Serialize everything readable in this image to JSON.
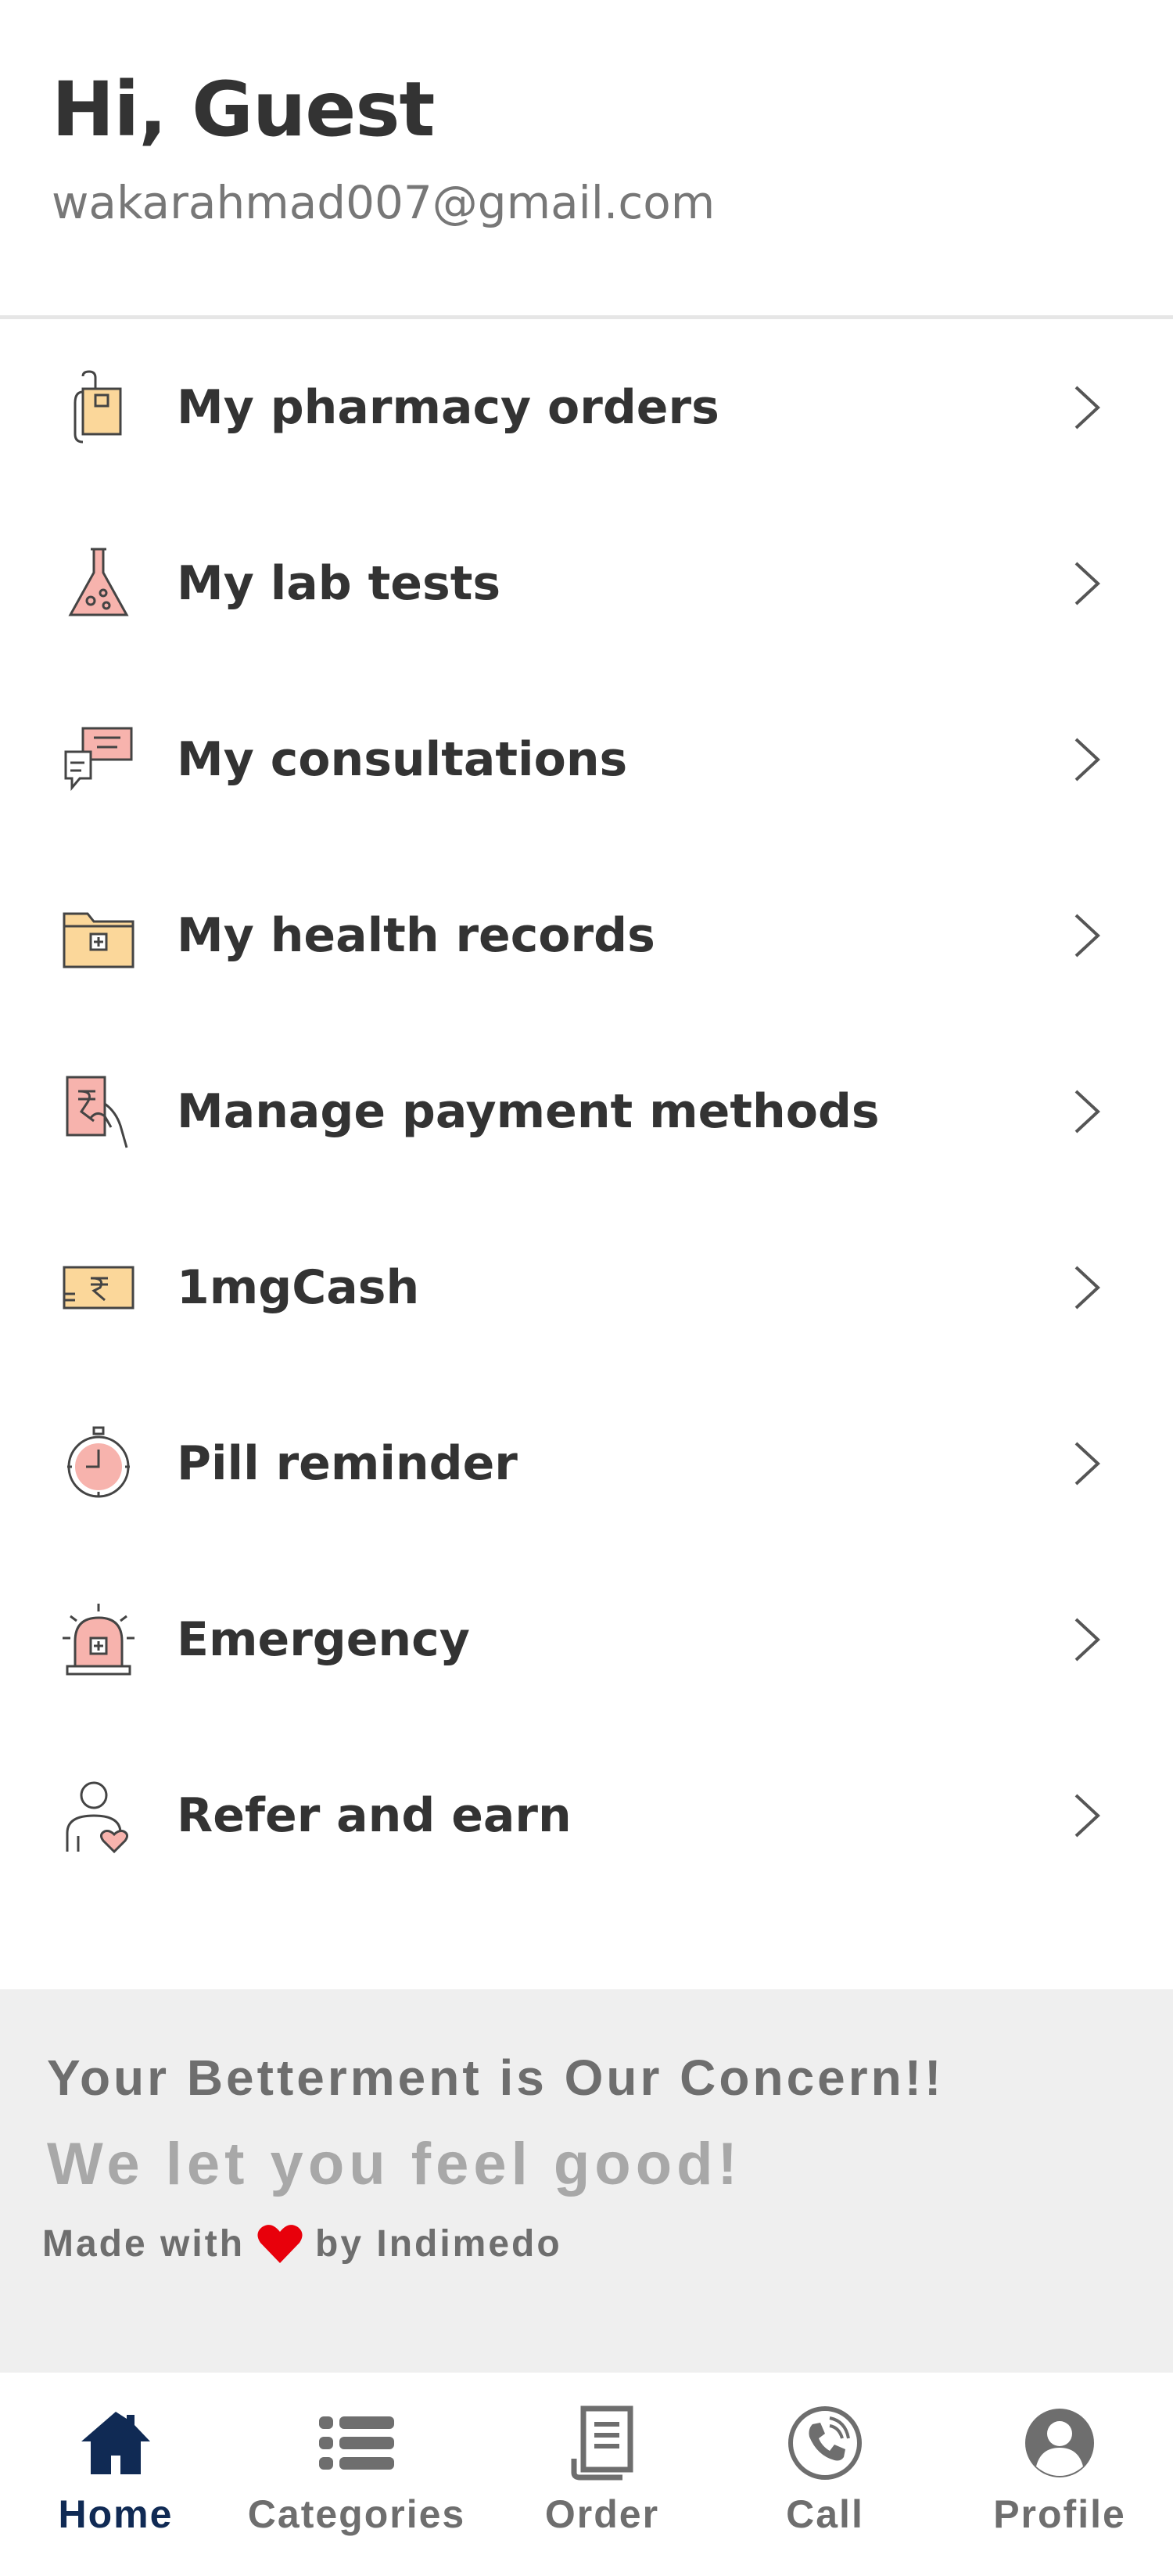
{
  "header": {
    "greeting": "Hi, Guest",
    "email": "wakarahmad007@gmail.com"
  },
  "menu": {
    "items": [
      {
        "label": "My pharmacy orders",
        "icon": "pharmacy-bag-icon"
      },
      {
        "label": "My lab tests",
        "icon": "lab-flask-icon"
      },
      {
        "label": "My consultations",
        "icon": "chat-bubbles-icon"
      },
      {
        "label": "My health records",
        "icon": "medical-folder-icon"
      },
      {
        "label": "Manage payment methods",
        "icon": "payment-hand-icon"
      },
      {
        "label": "1mgCash",
        "icon": "rupee-note-icon"
      },
      {
        "label": "Pill reminder",
        "icon": "stopwatch-icon"
      },
      {
        "label": "Emergency",
        "icon": "siren-icon"
      },
      {
        "label": "Refer and earn",
        "icon": "refer-person-icon"
      }
    ]
  },
  "banner": {
    "tagline": "Your Betterment is Our Concern!!",
    "subtag": "We let you feel good!",
    "made_with": "Made with",
    "by": "by Indimedo"
  },
  "tabs": [
    {
      "label": "Home",
      "icon": "home-icon",
      "active": true
    },
    {
      "label": "Categories",
      "icon": "list-icon",
      "active": false
    },
    {
      "label": "Order",
      "icon": "receipt-icon",
      "active": false
    },
    {
      "label": "Call",
      "icon": "phone-icon",
      "active": false
    },
    {
      "label": "Profile",
      "icon": "profile-icon",
      "active": false
    }
  ],
  "colors": {
    "accent": "#102a54",
    "text": "#333333",
    "muted": "#777777",
    "banner_bg": "#efefef",
    "icon_peach": "#f7b3ad",
    "icon_yellow": "#fbd79a",
    "heart": "#e8000b"
  }
}
